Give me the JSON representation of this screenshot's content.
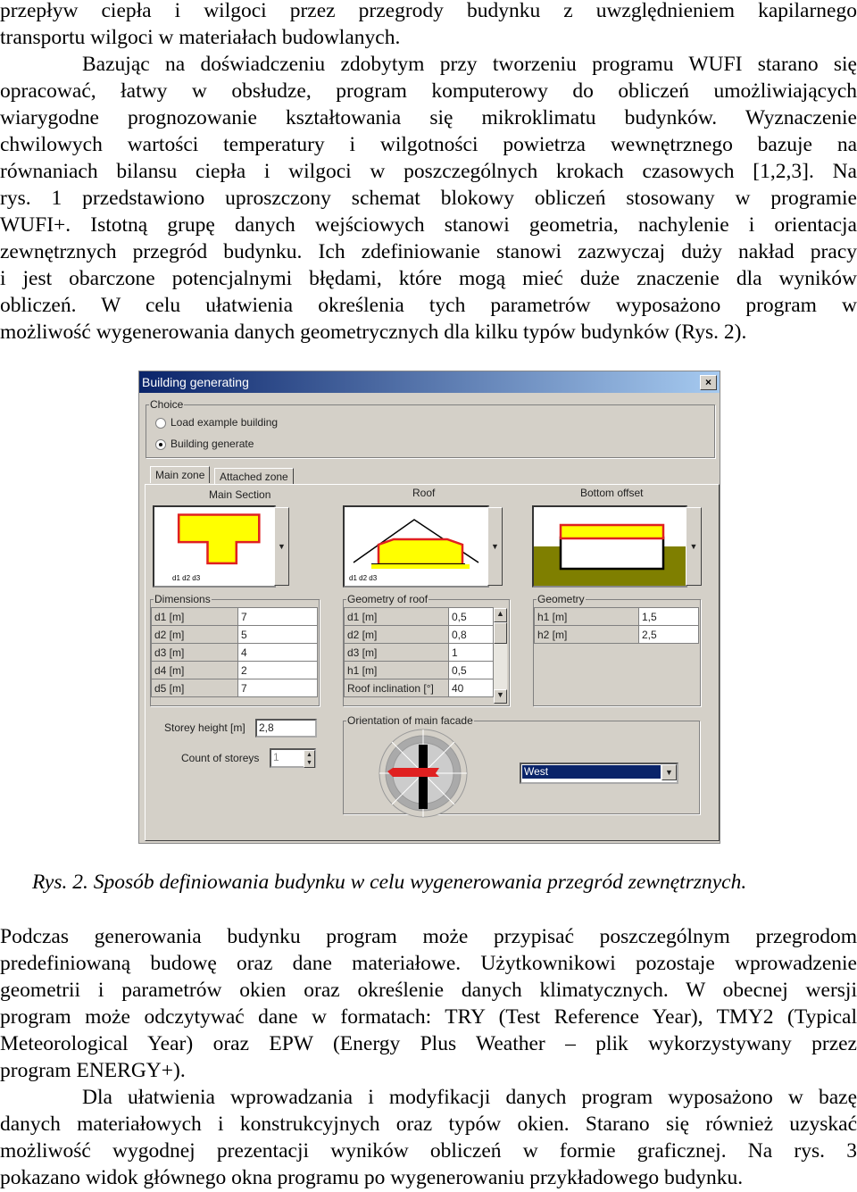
{
  "paragraph1": [
    "przepływ ciepła i wilgoci przez przegrody budynku z uwzględnieniem kapilarnego",
    "transportu wilgoci w materiałach budowlanych.",
    "Bazując na doświadczeniu zdobytym przy tworzeniu programu WUFI starano się",
    "opracować, łatwy w obsłudze, program komputerowy do obliczeń umożliwiających",
    "wiarygodne prognozowanie kształtowania się mikroklimatu budynków. Wyznaczenie",
    "chwilowych wartości temperatury i wilgotności powietrza wewnętrznego bazuje na",
    "równaniach bilansu ciepła i wilgoci w poszczególnych krokach czasowych [1,2,3]. Na",
    "rys. 1 przedstawiono uproszczony schemat blokowy obliczeń stosowany w programie",
    "WUFI+. Istotną grupę danych wejściowych stanowi geometria, nachylenie i orientacja",
    "zewnętrznych przegród budynku. Ich zdefiniowanie stanowi zazwyczaj duży nakład pracy",
    "i jest obarczone potencjalnymi błędami, które mogą mieć duże znaczenie dla wyników",
    "obliczeń. W celu ułatwienia określenia tych parametrów wyposażono program w",
    "możliwość wygenerowania danych geometrycznych dla kilku typów budynków (Rys. 2)."
  ],
  "caption": "Rys. 2. Sposób definiowania budynku w celu wygenerowania przegród zewnętrznych.",
  "paragraph2": [
    "Podczas generowania budynku program może przypisać poszczególnym przegrodom",
    "predefiniowaną budowę oraz dane materiałowe. Użytkownikowi pozostaje wprowadzenie",
    "geometrii i parametrów okien oraz określenie danych klimatycznych. W obecnej wersji",
    "program może odczytywać dane w formatach: TRY (Test Reference Year), TMY2 (Typical",
    "Meteorological Year) oraz EPW (Energy Plus Weather – plik wykorzystywany przez",
    "program ENERGY+).",
    "Dla ułatwienia wprowadzania i modyfikacji danych program wyposażono w bazę",
    "danych materiałowych i konstrukcyjnych oraz typów okien. Starano się również uzyskać",
    "możliwość wygodnej prezentacji wyników obliczeń w formie graficznej. Na rys. 3",
    "pokazano widok głównego okna programu po wygenerowaniu przykładowego budynku."
  ],
  "dialog": {
    "title": "Building generating",
    "close": "×",
    "choice": {
      "label": "Choice",
      "options": [
        "Load example building",
        "Building generate"
      ],
      "selected": 1
    },
    "tabs": [
      "Main zone",
      "Attached zone"
    ],
    "sections": [
      "Main Section",
      "Roof",
      "Bottom offset"
    ],
    "diagram_labels": {
      "main": "d1  d2  d3",
      "roof": "d1 d2 d3"
    },
    "dimensions": {
      "label": "Dimensions",
      "rows": [
        [
          "d1 [m]",
          "7"
        ],
        [
          "d2 [m]",
          "5"
        ],
        [
          "d3 [m]",
          "4"
        ],
        [
          "d4 [m]",
          "2"
        ],
        [
          "d5 [m]",
          "7"
        ]
      ]
    },
    "roof": {
      "label": "Geometry of roof",
      "rows": [
        [
          "d1 [m]",
          "0,5"
        ],
        [
          "d2 [m]",
          "0,8"
        ],
        [
          "d3 [m]",
          "1"
        ],
        [
          "h1 [m]",
          "0,5"
        ],
        [
          "Roof inclination [°]",
          "40"
        ]
      ]
    },
    "geometry": {
      "label": "Geometry",
      "rows": [
        [
          "h1 [m]",
          "1,5"
        ],
        [
          "h2 [m]",
          "2,5"
        ]
      ]
    },
    "storey_height": {
      "label": "Storey height [m]",
      "value": "2,8"
    },
    "count_storeys": {
      "label": "Count of storeys",
      "value": "1"
    },
    "orientation": {
      "label": "Orientation of main facade",
      "value": "West"
    },
    "colors": {
      "yellow": "#ffff00",
      "red": "#e02020",
      "ground": "#7f7f00",
      "selection": "#0a246a"
    }
  }
}
